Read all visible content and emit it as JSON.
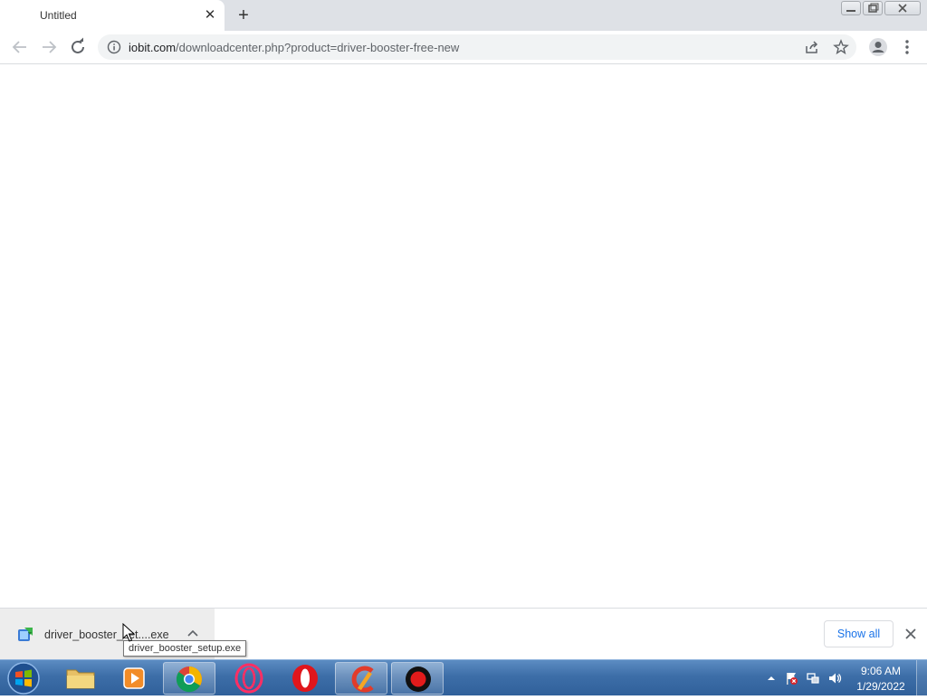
{
  "browser": {
    "tab_title": "Untitled",
    "tab_close_icon": "close-icon",
    "new_tab_icon": "plus-icon",
    "url_host": "iobit.com",
    "url_rest": "/downloadcenter.php?product=driver-booster-free-new"
  },
  "download_bar": {
    "file_name": "driver_booster_set....exe",
    "tooltip": "driver_booster_setup.exe",
    "show_all_label": "Show all"
  },
  "taskbar": {
    "time": "9:06 AM",
    "date": "1/29/2022",
    "apps": [
      "file-explorer",
      "media-player",
      "chrome",
      "opera-gx",
      "opera",
      "ccleaner",
      "recorder"
    ]
  },
  "colors": {
    "accent": "#1a73e8",
    "tabstrip": "#dee1e6",
    "taskbar": "#3d6ea8"
  }
}
